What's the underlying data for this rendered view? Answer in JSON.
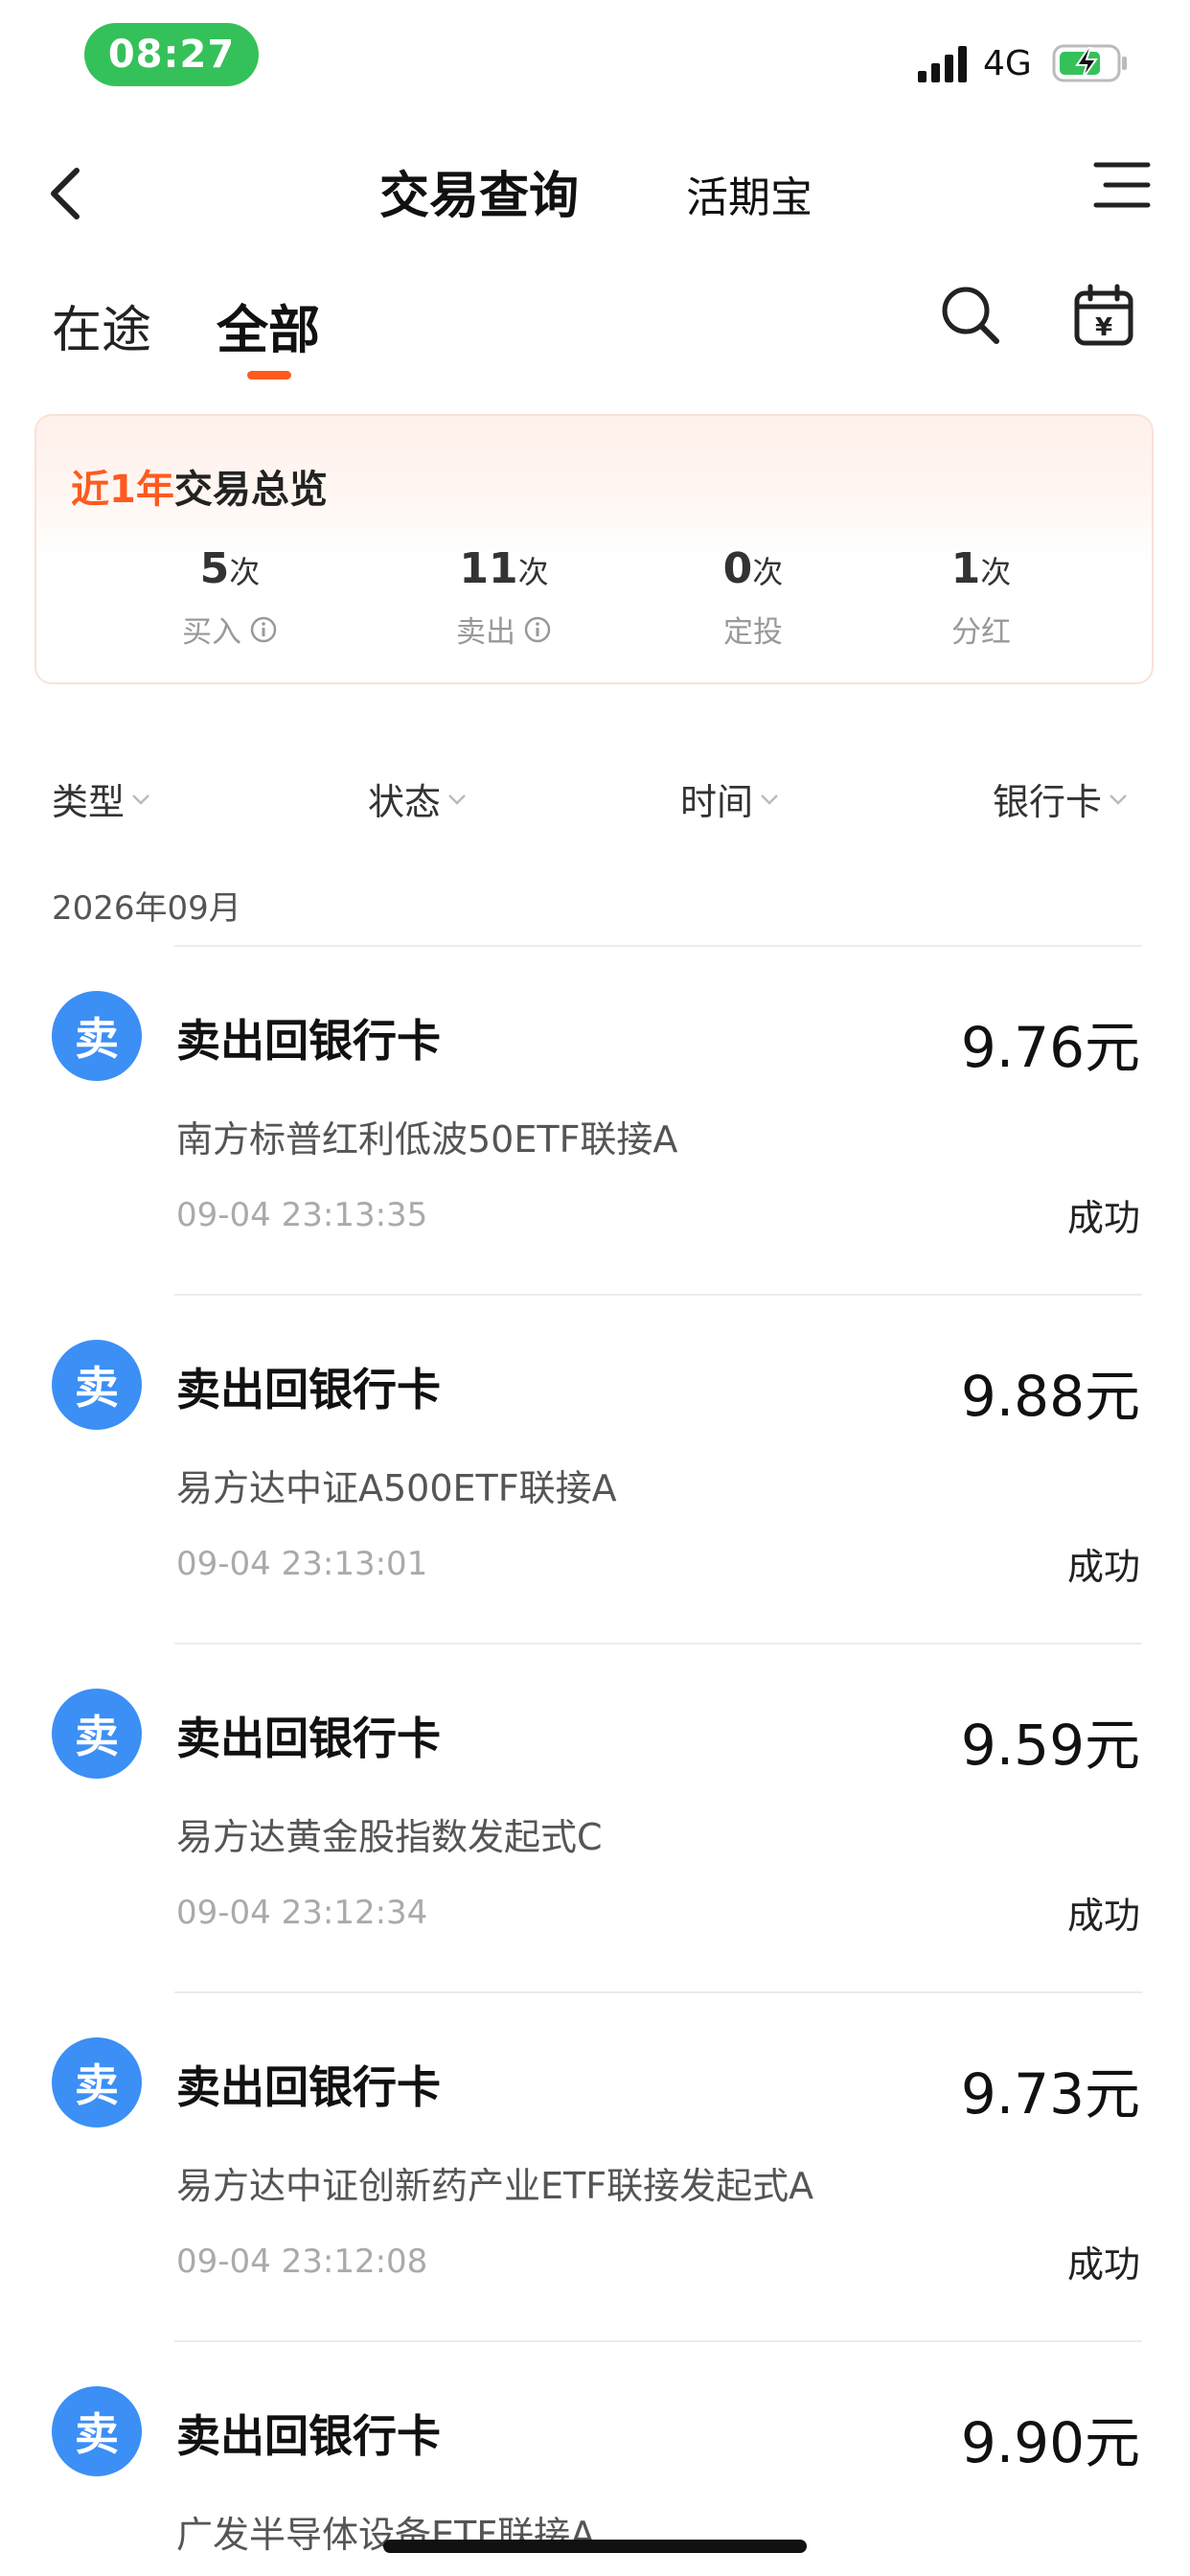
{
  "status_bar": {
    "time": "08:27",
    "network": "4G"
  },
  "nav": {
    "title": "交易查询",
    "sub_title": "活期宝"
  },
  "tabs": [
    {
      "label": "在途"
    },
    {
      "label": "全部"
    }
  ],
  "overview": {
    "title_prefix": "近",
    "title_year": "1年",
    "title_suffix": "交易总览",
    "stats": [
      {
        "value": "5",
        "unit": "次",
        "label": "买入"
      },
      {
        "value": "11",
        "unit": "次",
        "label": "卖出"
      },
      {
        "value": "0",
        "unit": "次",
        "label": "定投"
      },
      {
        "value": "1",
        "unit": "次",
        "label": "分红"
      }
    ]
  },
  "filters": [
    {
      "label": "类型"
    },
    {
      "label": "状态"
    },
    {
      "label": "时间"
    },
    {
      "label": "银行卡"
    }
  ],
  "month_header": "2026年09月",
  "transactions": [
    {
      "badge": "卖",
      "title": "卖出回银行卡",
      "amount": "9.76元",
      "fund": "南方标普红利低波50ETF联接A",
      "time": "09-04 23:13:35",
      "status": "成功"
    },
    {
      "badge": "卖",
      "title": "卖出回银行卡",
      "amount": "9.88元",
      "fund": "易方达中证A500ETF联接A",
      "time": "09-04 23:13:01",
      "status": "成功"
    },
    {
      "badge": "卖",
      "title": "卖出回银行卡",
      "amount": "9.59元",
      "fund": "易方达黄金股指数发起式C",
      "time": "09-04 23:12:34",
      "status": "成功"
    },
    {
      "badge": "卖",
      "title": "卖出回银行卡",
      "amount": "9.73元",
      "fund": "易方达中证创新药产业ETF联接发起式A",
      "time": "09-04 23:12:08",
      "status": "成功"
    },
    {
      "badge": "卖",
      "title": "卖出回银行卡",
      "amount": "9.90元",
      "fund": "广发半导体设备ETF联接A",
      "time": "",
      "status": ""
    }
  ]
}
